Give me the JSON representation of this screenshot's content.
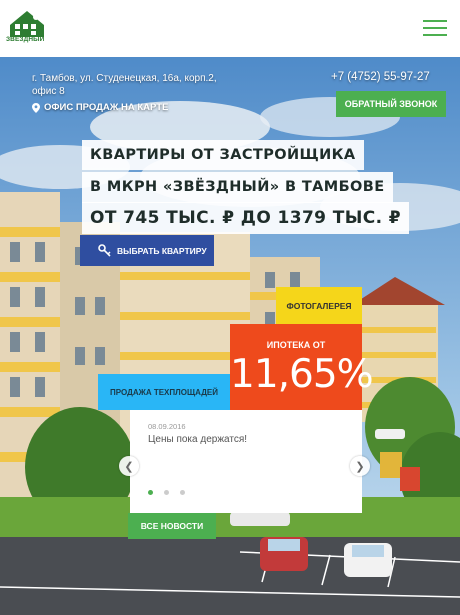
{
  "header": {
    "logo_text": "ЗВЁЗДНЫЙ",
    "menu_icon": "hamburger-icon"
  },
  "contacts": {
    "address": "г. Тамбов, ул. Студенецкая, 16а, корп.2, офис 8",
    "map_link": "ОФИС ПРОДАЖ НА КАРТЕ",
    "phone": "+7 (4752) 55-97-27",
    "callback": "ОБРАТНЫЙ ЗВОНОК"
  },
  "headline": {
    "line1": "КВАРТИРЫ ОТ ЗАСТРОЙЩИКА",
    "line2": "В МКРН «ЗВЁЗДНЫЙ» В ТАМБОВЕ",
    "line3": "ОТ 745 ТЫС. ₽ ДО 1379 ТЫС. ₽",
    "choose_button": "ВЫБРАТЬ КВАРТИРУ"
  },
  "tiles": {
    "gallery": "ФОТОГАЛЕРЕЯ",
    "mortgage_label": "ИПОТЕКА ОТ",
    "mortgage_value": "11,65%",
    "warehouse": "ПРОДАЖА ТЕХПЛОЩАДЕЙ"
  },
  "news": {
    "date": "08.09.2016",
    "text": "Цены пока держатся!",
    "slide_count": 3,
    "active_slide": 1,
    "all_news": "ВСЕ НОВОСТИ"
  },
  "colors": {
    "green": "#4caf50",
    "blue": "#2f4ea0",
    "yellow": "#f5d61a",
    "orange": "#ee4a1c",
    "cyan": "#29b6f6"
  }
}
